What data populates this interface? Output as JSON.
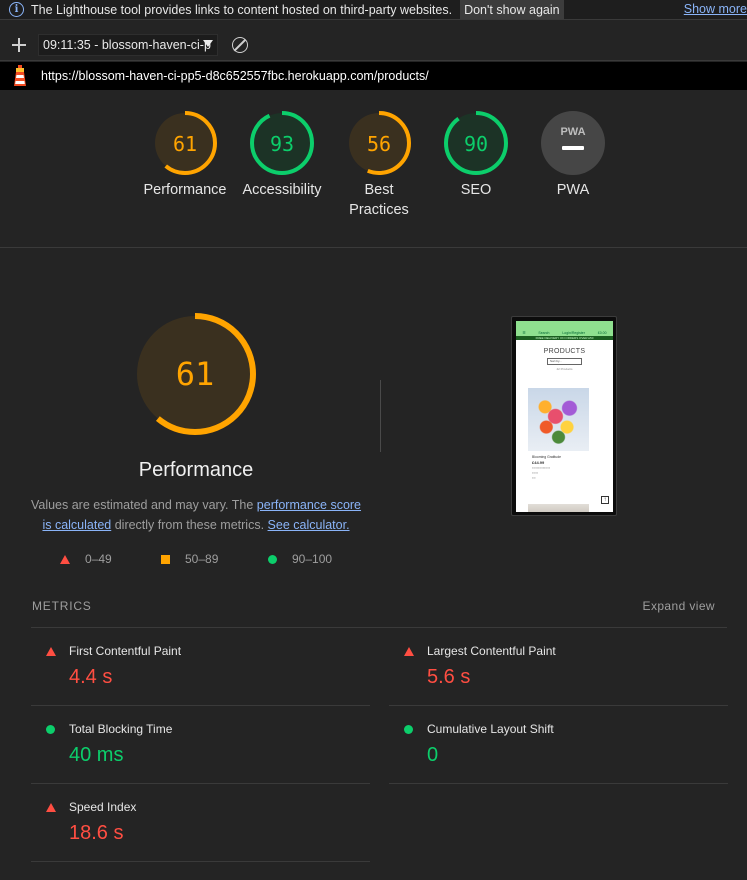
{
  "infobar": {
    "message": "The Lighthouse tool provides links to content hosted on third-party websites.",
    "dismiss_label": "Don't show again",
    "more_label": "Show more"
  },
  "toolbar": {
    "report_selector_value": "09:11:35 - blossom-haven-ci-p"
  },
  "urlbar": {
    "url": "https://blossom-haven-ci-pp5-d8c652557fbc.herokuapp.com/products/"
  },
  "categories": [
    {
      "label": "Performance",
      "score": 61,
      "rating": "average",
      "color": "#ffa400"
    },
    {
      "label": "Accessibility",
      "score": 93,
      "rating": "pass",
      "color": "#0cce6b"
    },
    {
      "label_line1": "Best",
      "label_line2": "Practices",
      "score": 56,
      "rating": "average",
      "color": "#ffa400"
    },
    {
      "label": "SEO",
      "score": 90,
      "rating": "pass",
      "color": "#0cce6b"
    },
    {
      "label": "PWA",
      "badge": "PWA",
      "rating": "not-applicable",
      "color": "#9e9e9e"
    }
  ],
  "performance": {
    "score": 61,
    "title": "Performance",
    "description_prefix": "Values are estimated and may vary. The",
    "link_score": "performance score is calculated",
    "link_score_part1": "performance score",
    "link_score_part2": "is calculated",
    "description_middle": "directly from these metrics.",
    "link_calculator": "See calculator."
  },
  "legend": {
    "fail": "0–49",
    "average": "50–89",
    "pass": "90–100"
  },
  "thumbnail": {
    "nav_items": [
      "Search",
      "Login/Register",
      "£0.00"
    ],
    "banner": "FREE DELIVERY ON ORDERS OVER £50",
    "title": "PRODUCTS",
    "sort": "Sort by...",
    "count": "42 Products",
    "product_name": "Blooming Gratitude",
    "product_price": "£44.99",
    "back_to_top": "↑"
  },
  "metrics": {
    "header": "METRICS",
    "expand_label": "Expand view",
    "items": [
      {
        "name": "First Contentful Paint",
        "value": "4.4 s",
        "rating": "fail"
      },
      {
        "name": "Largest Contentful Paint",
        "value": "5.6 s",
        "rating": "fail"
      },
      {
        "name": "Total Blocking Time",
        "value": "40 ms",
        "rating": "pass"
      },
      {
        "name": "Cumulative Layout Shift",
        "value": "0",
        "rating": "pass"
      },
      {
        "name": "Speed Index",
        "value": "18.6 s",
        "rating": "fail"
      }
    ]
  }
}
